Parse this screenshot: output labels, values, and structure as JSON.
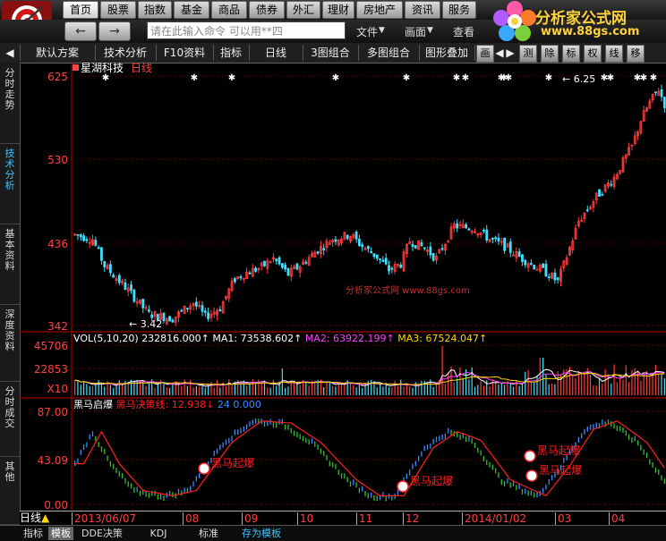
{
  "nav": {
    "buttons": [
      "首页",
      "股票",
      "指数",
      "基金",
      "商品",
      "债券",
      "外汇",
      "理财",
      "房地产",
      "资讯",
      "服务"
    ]
  },
  "row2": {
    "back_icon": "back-arrow-icon",
    "fwd_icon": "forward-arrow-icon",
    "command_placeholder": "请在此输入命令    可以用**四",
    "menu": [
      "文件",
      "画面",
      "查看"
    ]
  },
  "brand": {
    "name": "分析家公式网",
    "url": "www.88gs.com"
  },
  "toolbar": {
    "items": [
      "默认方案",
      "技术分析",
      "F10资料",
      "指标",
      "日线",
      "3图组合",
      "多图组合",
      "图形叠加"
    ],
    "small": [
      "画",
      "测",
      "除",
      "标",
      "权",
      "线",
      "移"
    ]
  },
  "left_tabs": [
    {
      "text": "分时走势"
    },
    {
      "text": "技术分析"
    },
    {
      "text": "基本资料"
    },
    {
      "text": "深度资料"
    },
    {
      "text": "分时成交"
    },
    {
      "text": "其他"
    }
  ],
  "chart_panel": {
    "stock_name": "星湖科技",
    "period": "日线",
    "price_axis": [
      "625",
      "530",
      "436",
      "342"
    ],
    "high_label": "6.25",
    "low_label": "3.42",
    "watermark": "分析家公式网  www.88gs.com",
    "vol_header": {
      "label": "VOL(5,10,20)",
      "vol": "232816.000",
      "ma1_label": "MA1:",
      "ma1": "73538.602",
      "ma2_label": "MA2:",
      "ma2": "63922.199",
      "ma3_label": "MA3:",
      "ma3": "67524.047"
    },
    "vol_axis": [
      "45706",
      "22853",
      "X10"
    ],
    "ind_header": {
      "name": "黑马启爆",
      "line_label": "黑马决策线:",
      "val1": "12.938",
      "val2": "24",
      "val3": "0.000"
    },
    "ind_axis": [
      "87.00",
      "43.09",
      "0.00"
    ],
    "signal_text": "黑马起爆"
  },
  "date_bar": {
    "label": "日线",
    "dates": [
      "2013/06/07",
      "08",
      "09",
      "10",
      "11",
      "12",
      "2014/01/02",
      "03",
      "04"
    ]
  },
  "bottom_tabs": [
    "指标",
    "模板",
    "DDE决策",
    "KDJ",
    "标准",
    "存为模板"
  ],
  "colors": {
    "up": "#ff3c3c",
    "down": "#40e0ff",
    "ma1": "#ffffff",
    "ma2": "#ff40ff",
    "ma3": "#ffd700",
    "ind_line": "#ff2020",
    "axis": "#c00000"
  }
}
